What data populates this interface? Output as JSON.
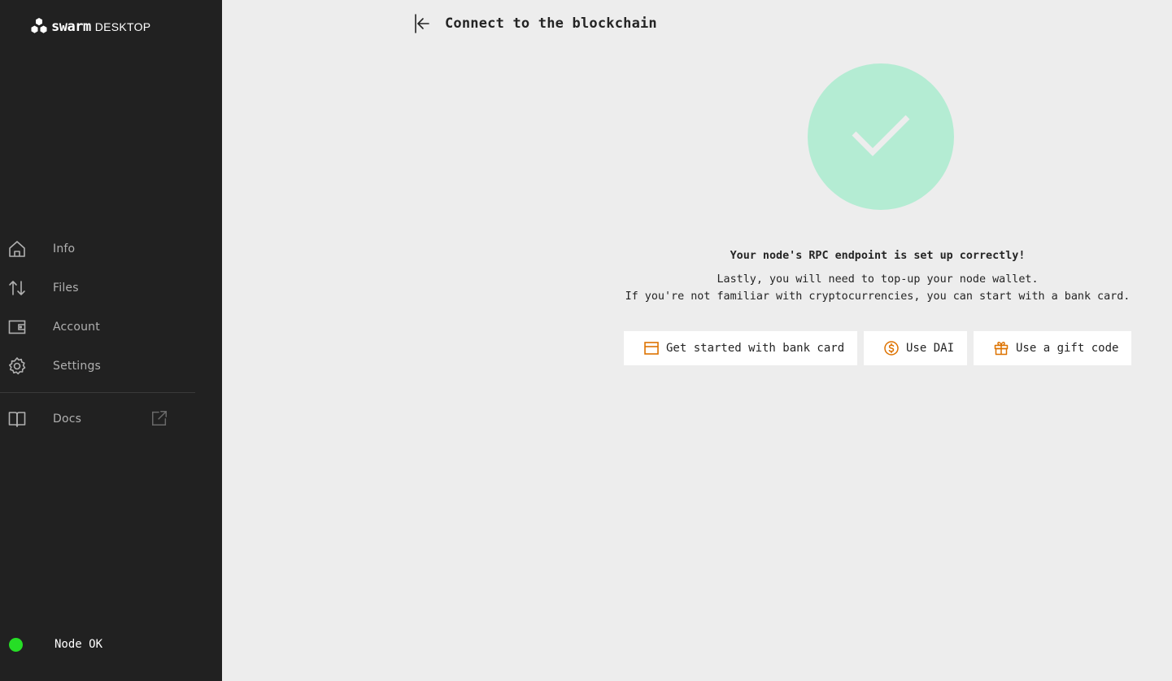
{
  "app": {
    "brand": "swarm",
    "brand_sub": "DESKTOP"
  },
  "sidebar": {
    "items": [
      {
        "label": "Info",
        "icon": "home-icon"
      },
      {
        "label": "Files",
        "icon": "arrows-up-down-icon"
      },
      {
        "label": "Account",
        "icon": "wallet-icon"
      },
      {
        "label": "Settings",
        "icon": "gear-icon"
      }
    ],
    "docs": {
      "label": "Docs",
      "icon": "book-icon",
      "external_icon": "external-link-icon"
    },
    "status": {
      "text": "Node OK",
      "color": "#26de26"
    }
  },
  "header": {
    "title": "Connect to the blockchain",
    "back_icon": "arrow-left-icon"
  },
  "main": {
    "success_icon": "checkmark-icon",
    "success_color": "#b4ecd3",
    "message_title": "Your node's RPC endpoint is set up correctly!",
    "message_line1": "Lastly, you will need to top-up your node wallet.",
    "message_line2": "If you're not familiar with cryptocurrencies, you can start with a bank card.",
    "buttons": [
      {
        "label": "Get started with bank card",
        "icon": "credit-card-icon"
      },
      {
        "label": "Use DAI",
        "icon": "dollar-coin-icon"
      },
      {
        "label": "Use a gift code",
        "icon": "gift-icon"
      }
    ],
    "accent_color": "#dd7200"
  }
}
